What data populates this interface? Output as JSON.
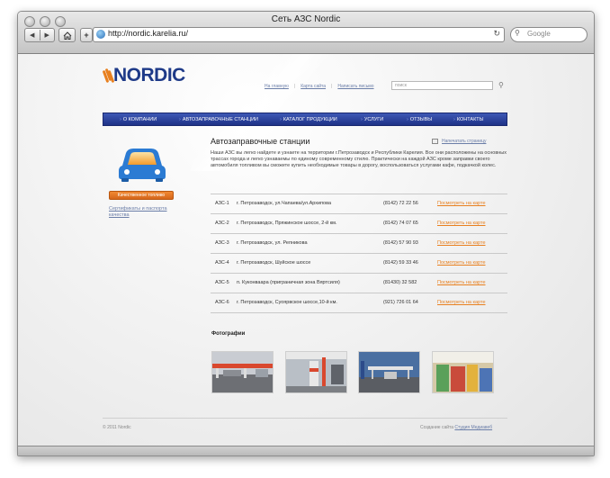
{
  "browser": {
    "window_title": "Сеть АЗС Nordic",
    "url": "http://nordic.karelia.ru/",
    "search_placeholder": "Google",
    "back_icon": "back-arrow-icon",
    "forward_icon": "forward-arrow-icon",
    "home_icon": "home-icon",
    "reload_icon": "reload-icon"
  },
  "header": {
    "logo_text": "NORDIC",
    "brand_color": "#1e3a88",
    "accent_color": "#e8801f",
    "links": [
      "На главную",
      "Карта сайта",
      "Написать письмо"
    ],
    "search_placeholder": "поиск"
  },
  "nav": {
    "items": [
      "О КОМПАНИИ",
      "АВТОЗАПРАВОЧНЫЕ СТАНЦИИ",
      "КАТАЛОГ ПРОДУКЦИИ",
      "УСЛУГИ",
      "ОТЗЫВЫ",
      "КОНТАКТЫ"
    ]
  },
  "sidebar": {
    "quality_button": "Качественное топливо",
    "cert_link": "Сертификаты и паспорта качества"
  },
  "main": {
    "title": "Автозаправочные станции",
    "print_link": "Напечатать страницу",
    "intro": "Наши АЗС вы легко найдете и узнаете на территории г.Петрозаводск и Республики Карелия. Все они расположены на основных трассах города и легко узнаваемы по единому современному стилю. Практически на каждой АЗС кроме заправки своего автомобиля топливом вы сможете купить необходимые товары в дорогу, воспользоваться услугами кафе, подкачкой колес.",
    "stations": [
      {
        "code": "АЗС-1",
        "address": "г. Петрозаводск, ул.Чапаева/ул.Архипова",
        "phone": "(8142) 72 22 56",
        "map_link": "Посмотреть на карте"
      },
      {
        "code": "АЗС-2",
        "address": "г. Петрозаводск, Пряжинское шоссе, 2-й км.",
        "phone": "(8142) 74 07 65",
        "map_link": "Посмотреть на карте"
      },
      {
        "code": "АЗС-3",
        "address": "г. Петрозаводск, ул. Репникова",
        "phone": "(8142) 57 90 93",
        "map_link": "Посмотреть на карте"
      },
      {
        "code": "АЗС-4",
        "address": "г. Петрозаводск, Шуйское шоссе",
        "phone": "(8142) 59 33 46",
        "map_link": "Посмотреть на карте"
      },
      {
        "code": "АЗС-5",
        "address": "п. Куконваара (приграничная зона Вяртсиля)",
        "phone": "(81430) 32 582",
        "map_link": "Посмотреть на карте"
      },
      {
        "code": "АЗС-6",
        "address": "г. Петрозаводск, Суоярвское шоссе,10-й км.",
        "phone": "(921) 726 01 64",
        "map_link": "Посмотреть на карте"
      }
    ],
    "photos_title": "Фотографии"
  },
  "footer": {
    "copyright": "© 2011 Nordic",
    "credits_prefix": "Создание сайта",
    "credits_link": "Студия Медиавеб"
  }
}
